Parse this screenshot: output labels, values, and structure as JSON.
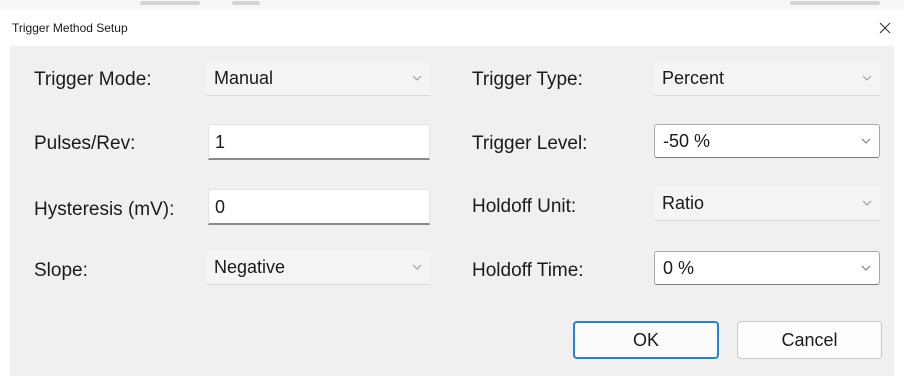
{
  "window": {
    "title": "Trigger Method Setup",
    "close_icon": "close-icon"
  },
  "left_column": {
    "trigger_mode": {
      "label": "Trigger Mode:",
      "value": "Manual"
    },
    "pulses_per_rev": {
      "label": "Pulses/Rev:",
      "value": "1"
    },
    "hysteresis": {
      "label": "Hysteresis (mV):",
      "value": "0"
    },
    "slope": {
      "label": "Slope:",
      "value": "Negative"
    }
  },
  "right_column": {
    "trigger_type": {
      "label": "Trigger Type:",
      "value": "Percent"
    },
    "trigger_level": {
      "label": "Trigger Level:",
      "value": "-50 %"
    },
    "holdoff_unit": {
      "label": "Holdoff Unit:",
      "value": "Ratio"
    },
    "holdoff_time": {
      "label": "Holdoff Time:",
      "value": "0 %"
    }
  },
  "buttons": {
    "ok_label": "OK",
    "cancel_label": "Cancel"
  },
  "colors": {
    "dialog_background": "#f0f0f0",
    "default_button_border": "#2f7fd0"
  }
}
